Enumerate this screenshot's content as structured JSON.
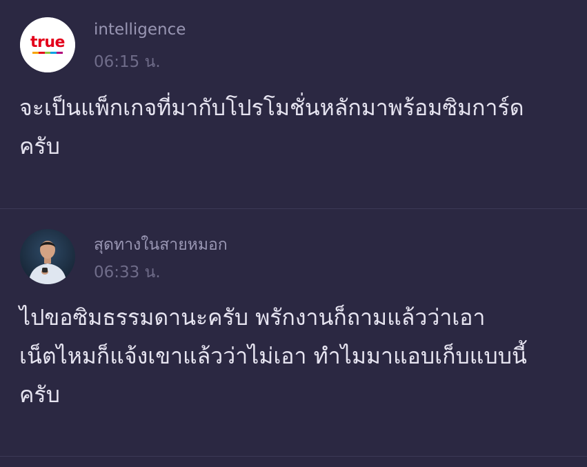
{
  "posts": [
    {
      "author": "intelligence",
      "time": "06:15 น.",
      "text": "จะเป็นแพ็กเกจที่มากับโปรโมชั่นหลักมาพร้อมซิมการ์ด\nครับ",
      "avatar": {
        "icon": "true-logo-icon",
        "logo_text": "true",
        "logo_color": "#e3001b"
      }
    },
    {
      "author": "สุดทางในสายหมอก",
      "time": "06:33 น.",
      "text": "ไปขอซิมธรรมดานะครับ พรักงานก็ถามแล้วว่าเอา\nเน็ตไหมก็แจ้งเขาแล้วว่าไม่เอา ทำไมมาแอบเก็บแบบนี้\nครับ",
      "avatar": {
        "icon": "user-photo-icon"
      }
    }
  ],
  "colors": {
    "background": "#2b2842",
    "divider": "#3c3956",
    "author_text": "#9996b3",
    "time_text": "#6f6c89",
    "body_text": "#e6e4f0"
  }
}
